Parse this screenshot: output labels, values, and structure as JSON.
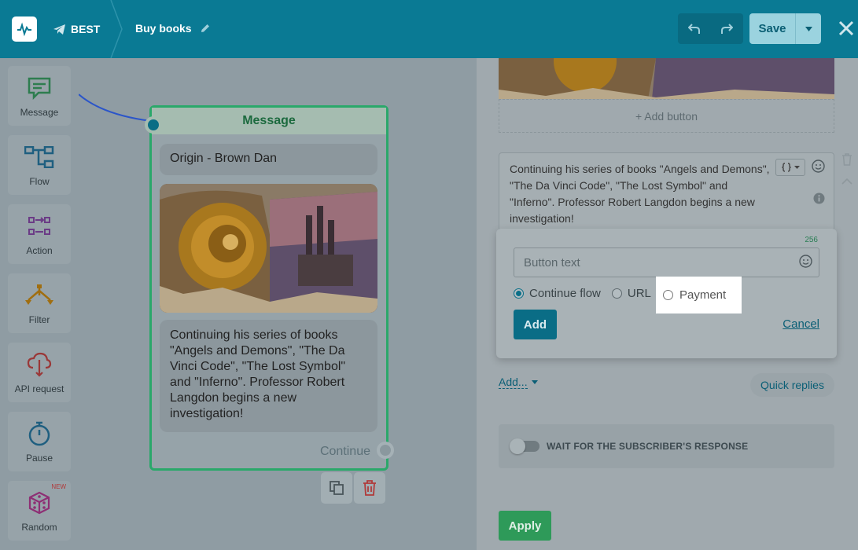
{
  "header": {
    "bot_name": "BEST",
    "flow_title": "Buy books",
    "save_label": "Save",
    "icons": [
      "pulse-logo-icon",
      "telegram-icon",
      "pencil-icon",
      "undo-icon",
      "redo-icon",
      "caret-down-icon",
      "close-icon"
    ]
  },
  "sidebar": {
    "items": [
      {
        "label": "Message",
        "icon": "message-icon",
        "color": "#2e8b57"
      },
      {
        "label": "Flow",
        "icon": "flow-icon",
        "color": "#1f6f96"
      },
      {
        "label": "Action",
        "icon": "action-icon",
        "color": "#7a3f9a"
      },
      {
        "label": "Filter",
        "icon": "filter-icon",
        "color": "#c98a12"
      },
      {
        "label": "API request",
        "icon": "api-cloud-icon",
        "color": "#b83a3a"
      },
      {
        "label": "Pause",
        "icon": "stopwatch-icon",
        "color": "#1f6f96"
      },
      {
        "label": "Random",
        "icon": "dice-icon",
        "color": "#a8398c",
        "badge": "NEW"
      }
    ]
  },
  "node": {
    "header": "Message",
    "title_text": "Origin - Brown Dan",
    "body_text": "Continuing his series of books \"Angels and Demons\", \"The Da Vinci Code\", \"The Lost Symbol\" and \"Inferno\". Professor Robert Langdon begins a new investigation!",
    "continue_label": "Continue"
  },
  "panel": {
    "add_button_label": "+ Add button",
    "message_text": "Continuing his series of books \"Angels and Demons\", \"The Da Vinci Code\", \"The Lost Symbol\" and \"Inferno\". Professor Robert Langdon begins a new investigation!",
    "add_menu_label": "Add...",
    "quick_replies_label": "Quick replies",
    "wait_label": "WAIT FOR THE SUBSCRIBER'S RESPONSE",
    "wait_enabled": false,
    "apply_label": "Apply"
  },
  "popup": {
    "counter": "256",
    "input_placeholder": "Button text",
    "input_value": "",
    "options": [
      {
        "label": "Continue flow",
        "selected": true
      },
      {
        "label": "URL",
        "selected": false
      },
      {
        "label": "Payment",
        "selected": false
      }
    ],
    "add_label": "Add",
    "cancel_label": "Cancel"
  },
  "colors": {
    "header_bg": "#0a7a94",
    "accent": "#0a6d86",
    "apply_green": "#2e9a59",
    "node_border": "#2aa86a",
    "connector": "#2b55c9"
  }
}
